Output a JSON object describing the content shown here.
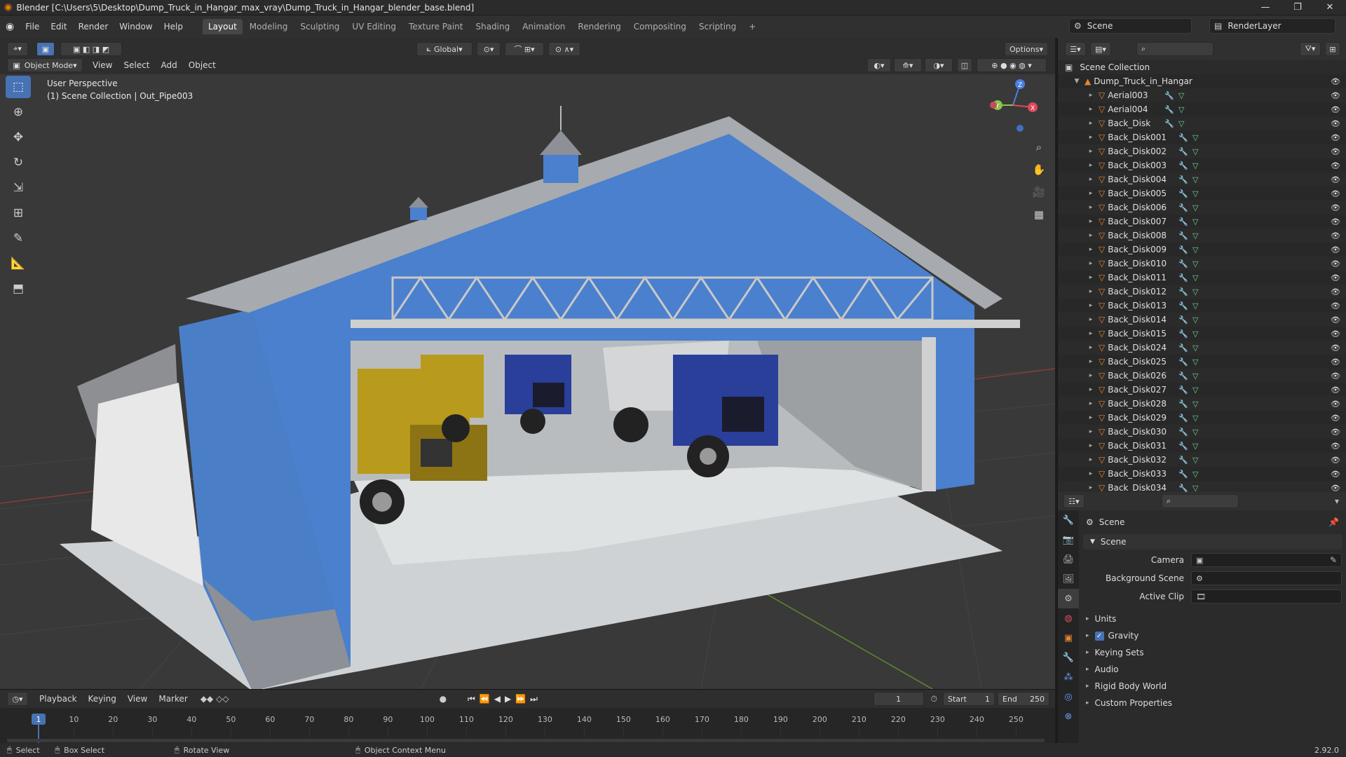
{
  "window": {
    "title": "Blender [C:\\Users\\5\\Desktop\\Dump_Truck_in_Hangar_max_vray\\Dump_Truck_in_Hangar_blender_base.blend]",
    "controls": [
      "—",
      "❐",
      "✕"
    ]
  },
  "menu": {
    "items": [
      "File",
      "Edit",
      "Render",
      "Window",
      "Help"
    ],
    "workspaces": [
      "Layout",
      "Modeling",
      "Sculpting",
      "UV Editing",
      "Texture Paint",
      "Shading",
      "Animation",
      "Rendering",
      "Compositing",
      "Scripting"
    ],
    "active_workspace": "Layout",
    "add_workspace": "+",
    "scene": "Scene",
    "view_layer": "RenderLayer"
  },
  "viewport_header": {
    "mode": "Object Mode",
    "menus": [
      "View",
      "Select",
      "Add",
      "Object"
    ],
    "transform_orientation": "Global",
    "options": "Options"
  },
  "viewport": {
    "perspective_label": "User Perspective",
    "collection_label": "(1) Scene Collection | Out_Pipe003",
    "gizmo_axes": {
      "z": "Z",
      "y": "Y",
      "x": "X"
    },
    "colors": {
      "background": "#393939",
      "hangar_blue": "#4a7fc8",
      "truck_yellow": "#b89a1c",
      "truck_blue": "#2a3f9a",
      "floor": "#c9ccce"
    }
  },
  "tools": [
    "select-box",
    "cursor",
    "move",
    "rotate",
    "scale",
    "transform",
    "annotate",
    "measure",
    "add-cube"
  ],
  "outliner": {
    "root": "Scene Collection",
    "collection": "Dump_Truck_in_Hangar",
    "objects": [
      "Aerial003",
      "Aerial004",
      "Back_Disk",
      "Back_Disk001",
      "Back_Disk002",
      "Back_Disk003",
      "Back_Disk004",
      "Back_Disk005",
      "Back_Disk006",
      "Back_Disk007",
      "Back_Disk008",
      "Back_Disk009",
      "Back_Disk010",
      "Back_Disk011",
      "Back_Disk012",
      "Back_Disk013",
      "Back_Disk014",
      "Back_Disk015",
      "Back_Disk024",
      "Back_Disk025",
      "Back_Disk026",
      "Back_Disk027",
      "Back_Disk028",
      "Back_Disk029",
      "Back_Disk030",
      "Back_Disk031",
      "Back_Disk032",
      "Back_Disk033",
      "Back_Disk034"
    ]
  },
  "properties": {
    "context": "Scene",
    "panel": "Scene",
    "fields": [
      {
        "label": "Camera",
        "value": ""
      },
      {
        "label": "Background Scene",
        "value": ""
      },
      {
        "label": "Active Clip",
        "value": ""
      }
    ],
    "sections": [
      "Units",
      "Gravity",
      "Keying Sets",
      "Audio",
      "Rigid Body World",
      "Custom Properties"
    ],
    "gravity_checked": true
  },
  "timeline": {
    "menus": [
      "Playback",
      "Keying",
      "View",
      "Marker"
    ],
    "current_frame": "1",
    "start_label": "Start",
    "start": "1",
    "end_label": "End",
    "end": "250",
    "ruler": [
      "10",
      "20",
      "30",
      "40",
      "50",
      "60",
      "70",
      "80",
      "90",
      "100",
      "110",
      "120",
      "130",
      "140",
      "150",
      "160",
      "170",
      "180",
      "190",
      "200",
      "210",
      "220",
      "230",
      "240",
      "250"
    ],
    "playhead": "1"
  },
  "statusbar": {
    "select": "Select",
    "box_select": "Box Select",
    "rotate_view": "Rotate View",
    "context_menu": "Object Context Menu",
    "version": "2.92.0"
  }
}
